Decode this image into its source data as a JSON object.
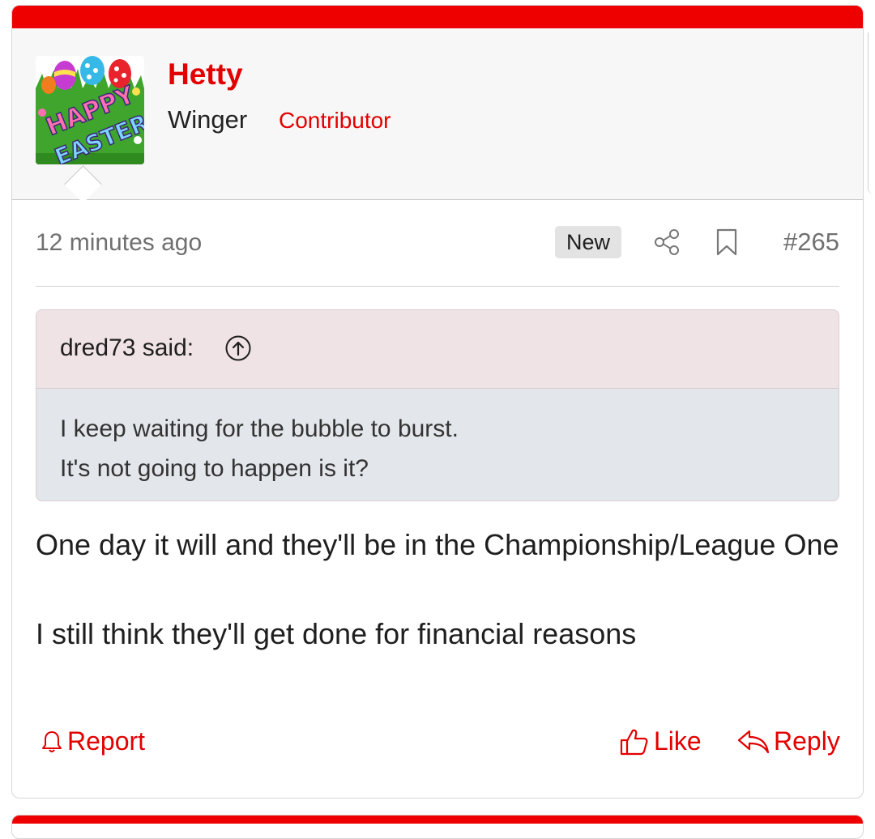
{
  "post": {
    "user": {
      "name": "Hetty",
      "title": "Winger",
      "banner": "Contributor",
      "avatar_text": [
        "HAPPY",
        "EASTER"
      ]
    },
    "meta": {
      "timestamp": "12 minutes ago",
      "badge": "New",
      "post_number": "#265",
      "icons": [
        "share-icon",
        "bookmark-icon"
      ]
    },
    "quote": {
      "author_line": "dred73 said:",
      "lines": [
        "I keep waiting for the bubble to burst.",
        "It's not going to happen is it?"
      ]
    },
    "message": {
      "paragraphs": [
        "One day it will and they'll be in the Championship/League One",
        "I still think they'll get done for financial reasons"
      ]
    },
    "actions": {
      "report": "Report",
      "like": "Like",
      "reply": "Reply"
    }
  },
  "colors": {
    "accent": "#e30000",
    "top_bar": "#ee0000",
    "quote_header_bg": "#f0e3e6",
    "quote_body_bg": "#e3e6ea",
    "muted_text": "#707070"
  }
}
